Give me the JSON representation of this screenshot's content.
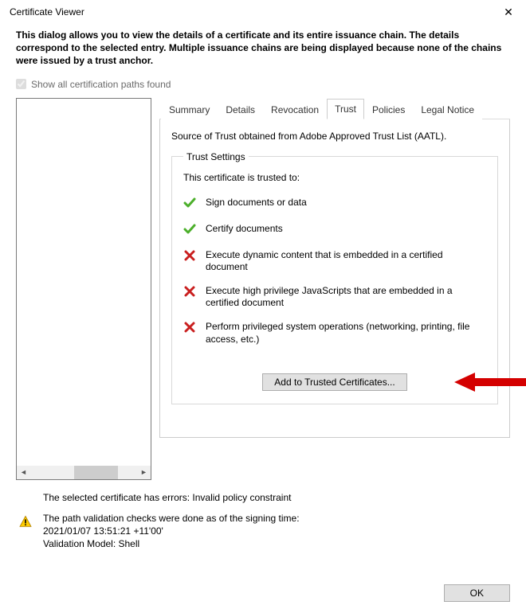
{
  "window": {
    "title": "Certificate Viewer"
  },
  "intro": "This dialog allows you to view the details of a certificate and its entire issuance chain. The details correspond to the selected entry. Multiple issuance chains are being displayed because none of the chains were issued by a trust anchor.",
  "checkbox": {
    "label": "Show all certification paths found",
    "checked": true
  },
  "tabs": [
    "Summary",
    "Details",
    "Revocation",
    "Trust",
    "Policies",
    "Legal Notice"
  ],
  "activeTabIndex": 3,
  "trust": {
    "source_line": "Source of Trust obtained from Adobe Approved Trust List (AATL).",
    "legend": "Trust Settings",
    "trusted_to": "This certificate is trusted to:",
    "permissions": [
      {
        "ok": true,
        "text": "Sign documents or data"
      },
      {
        "ok": true,
        "text": "Certify documents"
      },
      {
        "ok": false,
        "text": "Execute dynamic content that is embedded in a certified document"
      },
      {
        "ok": false,
        "text": "Execute high privilege JavaScripts that are embedded in a certified document"
      },
      {
        "ok": false,
        "text": "Perform privileged system operations (networking, printing, file access, etc.)"
      }
    ],
    "add_button": "Add to Trusted Certificates..."
  },
  "bottom": {
    "error_line": "The selected certificate has errors: Invalid policy constraint",
    "path_line": "The path validation checks were done as of the signing time:",
    "timestamp": "2021/01/07 13:51:21 +11'00'",
    "model_line": "Validation Model: Shell"
  },
  "footer": {
    "ok": "OK"
  }
}
